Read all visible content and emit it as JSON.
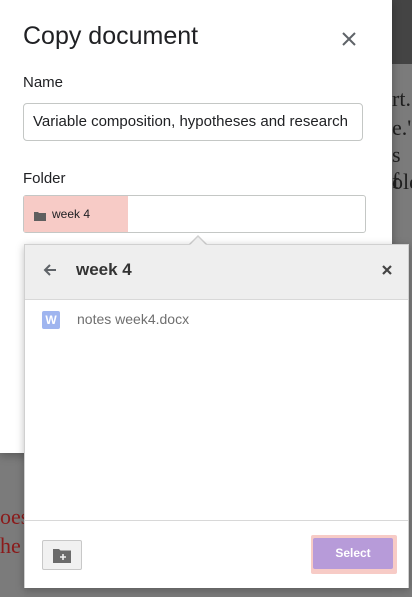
{
  "dialog": {
    "title": "Copy document",
    "close_icon": "close-icon",
    "name_label": "Name",
    "name_value": "Variable composition, hypotheses and research",
    "folder_label": "Folder",
    "folder_value": "week 4",
    "folder_icon": "folder-icon"
  },
  "picker": {
    "title": "week 4",
    "back_icon": "arrow-left-icon",
    "close_icon": "close-icon",
    "files": [
      {
        "name": "notes week4.docx",
        "icon": "word-doc-icon",
        "icon_letter": "W"
      }
    ],
    "new_folder_icon": "new-folder-icon",
    "select_label": "Select"
  },
  "background": {
    "fragments": [
      "rt.",
      "e.'",
      "s f",
      "ole"
    ],
    "red_fragments": [
      "oes",
      "he"
    ]
  },
  "colors": {
    "highlight": "#f7cbc6",
    "select_button": "#b79bd9",
    "word_icon": "#9fb5ef"
  }
}
